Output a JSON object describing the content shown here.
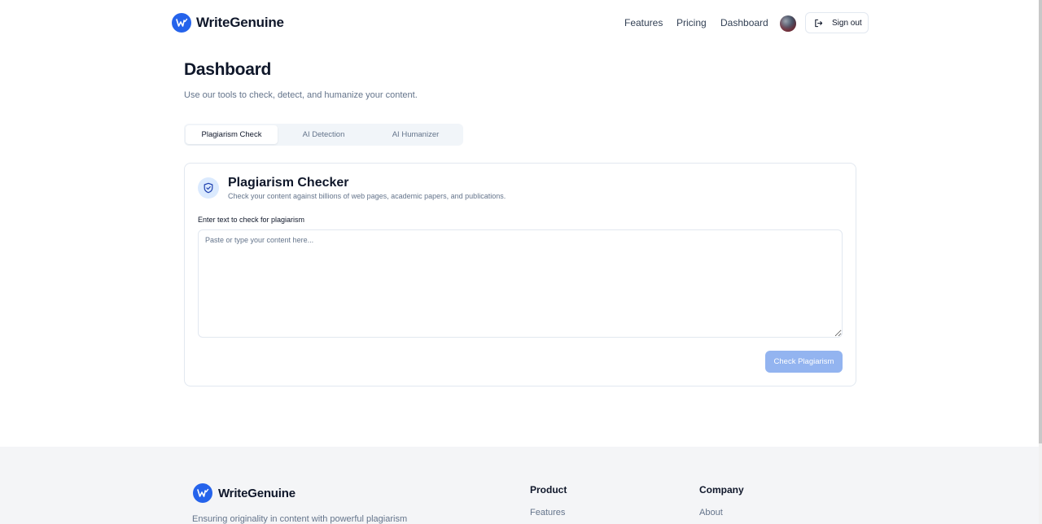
{
  "header": {
    "brand": "WriteGenuine",
    "nav": [
      "Features",
      "Pricing",
      "Dashboard"
    ],
    "signout_label": "Sign out"
  },
  "page": {
    "title": "Dashboard",
    "subtitle": "Use our tools to check, detect, and humanize your content."
  },
  "tabs": [
    {
      "label": "Plagiarism Check",
      "active": true
    },
    {
      "label": "AI Detection",
      "active": false
    },
    {
      "label": "AI Humanizer",
      "active": false
    }
  ],
  "card": {
    "title": "Plagiarism Checker",
    "description": "Check your content against billions of web pages, academic papers, and publications.",
    "field_label": "Enter text to check for plagiarism",
    "textarea_value": "",
    "textarea_placeholder": "Paste or type your content here...",
    "button_label": "Check Plagiarism",
    "button_disabled": true
  },
  "footer": {
    "brand": "WriteGenuine",
    "tagline": "Ensuring originality in content with powerful plagiarism",
    "columns": [
      {
        "title": "Product",
        "links": [
          "Features"
        ]
      },
      {
        "title": "Company",
        "links": [
          "About"
        ]
      }
    ]
  },
  "icons": {
    "logo": "pen-check-logo-icon",
    "signout": "sign-out-icon",
    "card": "shield-check-icon"
  },
  "colors": {
    "primary": "#2563eb",
    "button_disabled": "#93b4f0",
    "icon_bg": "#dbeafe",
    "footer_bg": "#f4f5f7"
  }
}
